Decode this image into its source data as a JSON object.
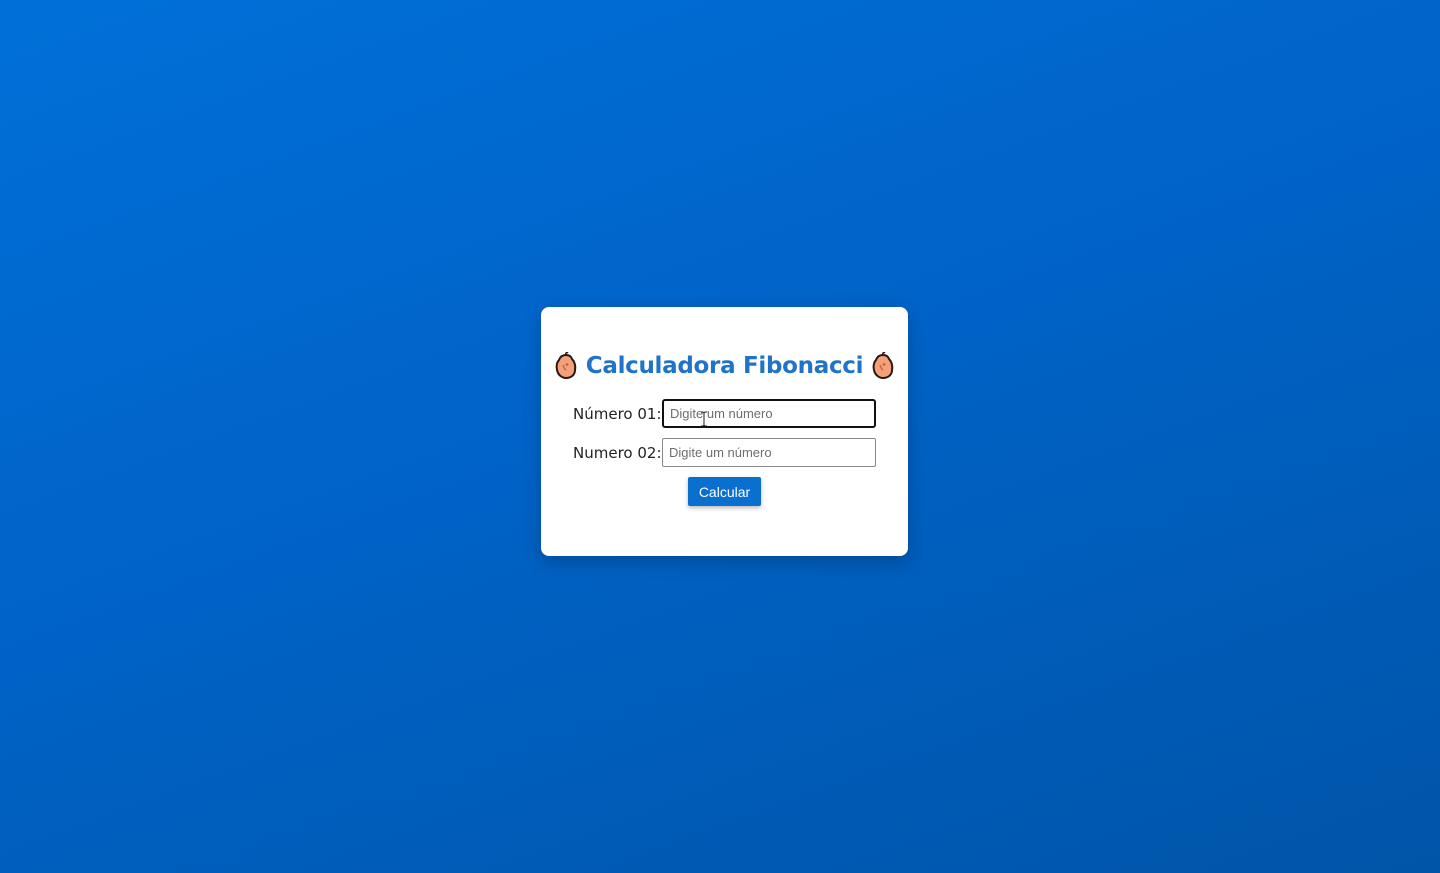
{
  "card": {
    "title": "Calculadora Fibonacci",
    "title_icon": "peach-icon",
    "title_color": "#1f73c9"
  },
  "form": {
    "field1": {
      "label": "Número 01:",
      "placeholder": "Digite um número",
      "value": "",
      "focused": true
    },
    "field2": {
      "label": "Numero 02:",
      "placeholder": "Digite um número",
      "value": ""
    },
    "submit_label": "Calcular",
    "button_color": "#0a70d0"
  },
  "background_colors": [
    "#0070d8",
    "#0055a8"
  ]
}
